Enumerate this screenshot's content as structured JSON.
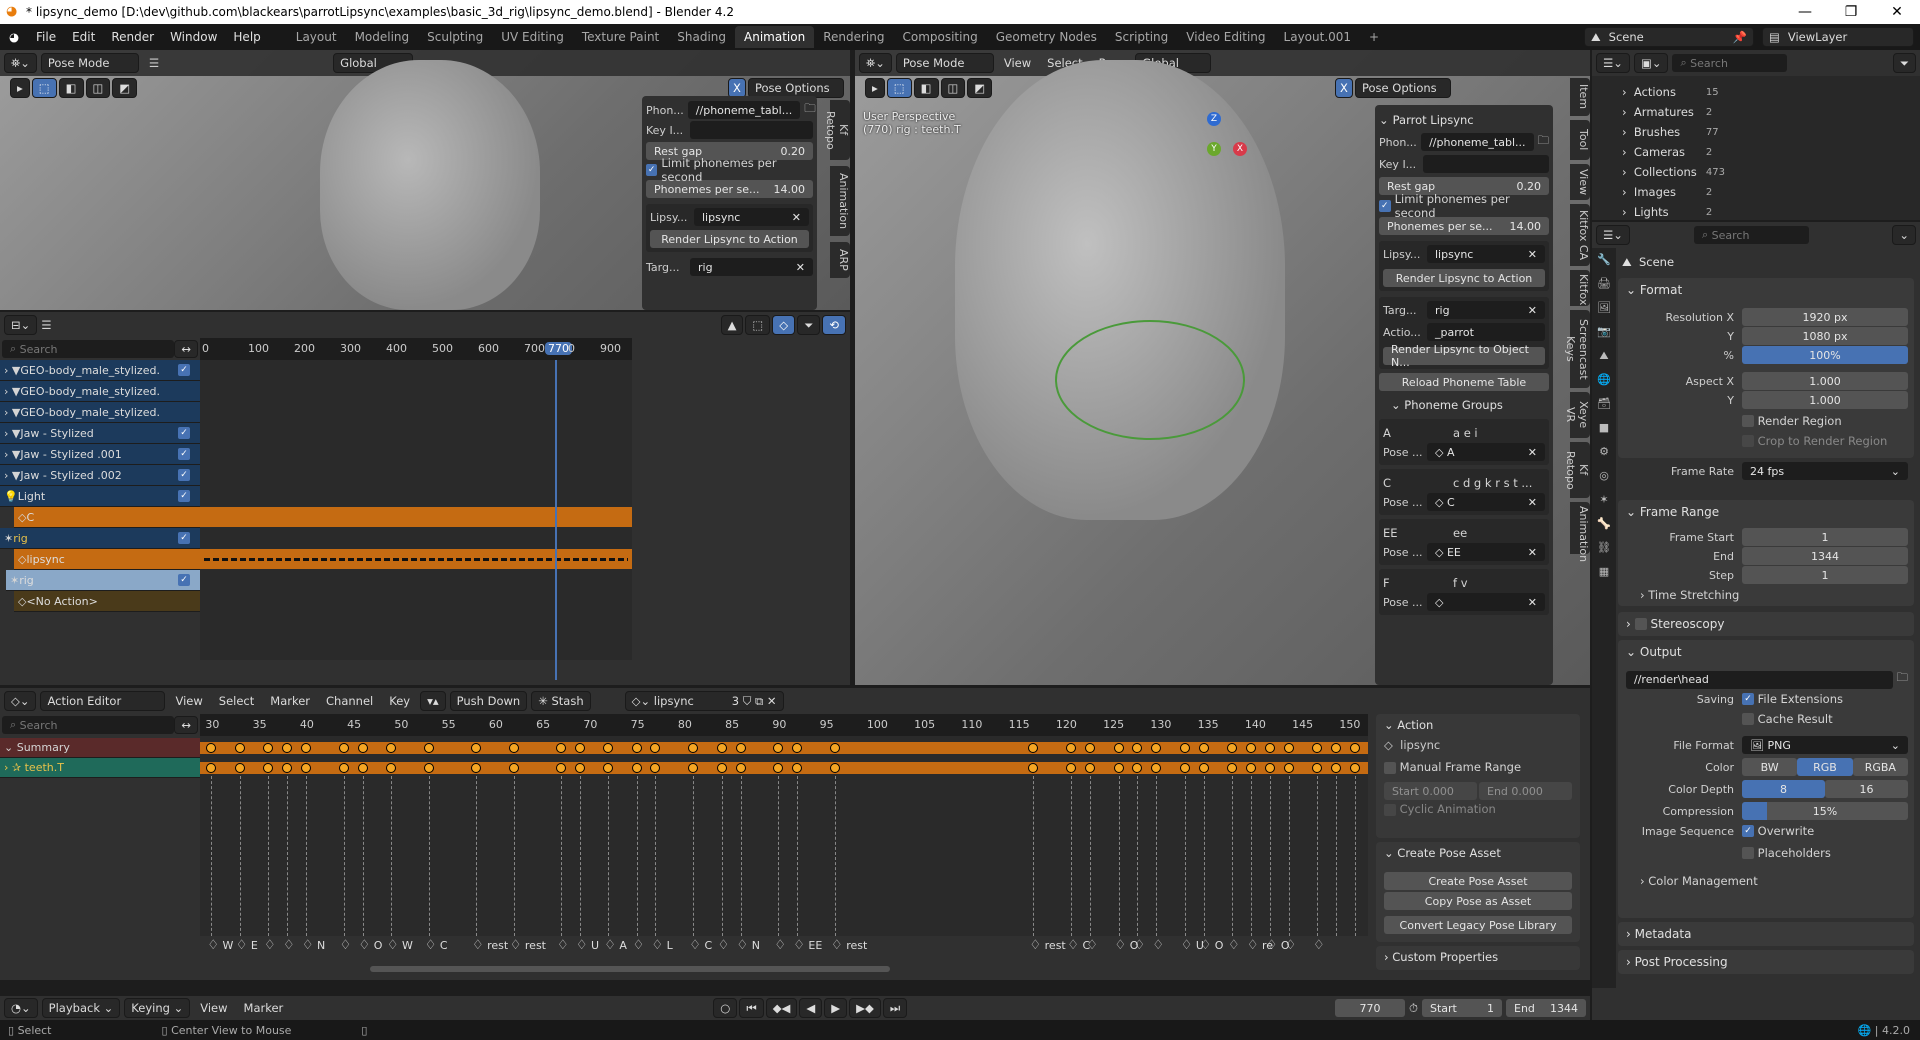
{
  "window": {
    "title": "* lipsync_demo [D:\\dev\\github.com\\blackears\\parrotLipsync\\examples\\basic_3d_rig\\lipsync_demo.blend] - Blender 4.2",
    "minimize": "—",
    "maximize": "❐",
    "close": "✕"
  },
  "menubar": {
    "items": [
      "File",
      "Edit",
      "Render",
      "Window",
      "Help"
    ],
    "workspaces": [
      "Layout",
      "Modeling",
      "Sculpting",
      "UV Editing",
      "Texture Paint",
      "Shading",
      "Animation",
      "Rendering",
      "Compositing",
      "Geometry Nodes",
      "Scripting",
      "Video Editing",
      "Layout.001",
      "+"
    ],
    "active_workspace": "Animation",
    "scene": "Scene",
    "view_layer": "ViewLayer"
  },
  "left_viewport": {
    "mode": "Pose Mode",
    "orientation": "Global",
    "pose_options": "Pose Options",
    "x_mirror": "X",
    "sidebar_tabs": [
      "Kf Retopo",
      "Animation",
      "ARP"
    ],
    "lipsync": {
      "phoneme_label": "Phon...",
      "phoneme_value": "//phoneme_tabl...",
      "key_label": "Key I...",
      "rest_gap_label": "Rest gap",
      "rest_gap": "0.20",
      "limit_label": "Limit phonemes per second",
      "pps_label": "Phonemes per se...",
      "pps": "14.00",
      "lipsync_label": "Lipsy...",
      "lipsync_value": "lipsync",
      "render_action": "Render Lipsync to Action",
      "target_label": "Targ...",
      "target_value": "rig"
    }
  },
  "right_viewport": {
    "mode": "Pose Mode",
    "menus": [
      "View",
      "Select",
      "Pose"
    ],
    "orientation": "Global",
    "pose_options": "Pose Options",
    "x_mirror": "X",
    "overlay_line1": "User Perspective",
    "overlay_line2": "(770) rig : teeth.T",
    "gizmo": {
      "z": "Z",
      "y": "Y",
      "x": "X"
    },
    "sidebar_tabs": [
      "Item",
      "Tool",
      "View",
      "Kitfox CA",
      "Kitfox",
      "Screencast Keys",
      "Xeye VR",
      "Kf Retopo",
      "Animation"
    ],
    "parrot": {
      "title": "Parrot Lipsync",
      "phoneme_label": "Phon...",
      "phoneme_value": "//phoneme_tabl...",
      "key_label": "Key I...",
      "rest_gap_label": "Rest gap",
      "rest_gap": "0.20",
      "limit_label": "Limit phonemes per second",
      "pps_label": "Phonemes per se...",
      "pps": "14.00",
      "lipsync_label": "Lipsy...",
      "lipsync_value": "lipsync",
      "render_action": "Render Lipsync to Action",
      "target_label": "Targ...",
      "target_value": "rig",
      "action_label": "Actio...",
      "action_value": "_parrot",
      "render_object": "Render Lipsync to Object N...",
      "reload": "Reload Phoneme Table",
      "groups_title": "Phoneme Groups",
      "pose_label": "Pose ...",
      "groups": [
        {
          "name": "A",
          "phonemes": "a e i",
          "pose": "A"
        },
        {
          "name": "C",
          "phonemes": "c d g k r s t ...",
          "pose": "C"
        },
        {
          "name": "EE",
          "phonemes": "ee",
          "pose": "EE"
        },
        {
          "name": "F",
          "phonemes": "f v",
          "pose": ""
        }
      ]
    }
  },
  "nla": {
    "search_placeholder": "Search",
    "ruler": [
      "0",
      "100",
      "200",
      "300",
      "400",
      "500",
      "600",
      "700",
      "770",
      "0",
      "900"
    ],
    "current_frame": "770",
    "tracks": [
      {
        "name": "GEO-body_male_stylized.",
        "type": "object",
        "checked": true
      },
      {
        "name": "GEO-body_male_stylized.",
        "type": "object",
        "checked": false
      },
      {
        "name": "GEO-body_male_stylized.",
        "type": "object",
        "checked": false
      },
      {
        "name": "Jaw - Stylized",
        "type": "object",
        "checked": true
      },
      {
        "name": "Jaw - Stylized .001",
        "type": "object",
        "checked": true
      },
      {
        "name": "Jaw - Stylized .002",
        "type": "object",
        "checked": true
      },
      {
        "name": "Light",
        "type": "light",
        "checked": true
      },
      {
        "name": "C",
        "type": "action",
        "checked": false
      },
      {
        "name": "rig",
        "type": "armature",
        "checked": true
      },
      {
        "name": "lipsync",
        "type": "action",
        "checked": false
      },
      {
        "name": "rig",
        "type": "armature-sel",
        "checked": true
      },
      {
        "name": "<No Action>",
        "type": "noaction",
        "checked": false
      }
    ]
  },
  "action_editor": {
    "mode": "Action Editor",
    "menus": [
      "View",
      "Select",
      "Marker",
      "Channel",
      "Key"
    ],
    "push_down": "Push Down",
    "stash": "Stash",
    "action_name": "lipsync",
    "users": "3",
    "search_placeholder": "Search",
    "ruler": [
      "30",
      "35",
      "40",
      "45",
      "50",
      "55",
      "60",
      "65",
      "70",
      "75",
      "80",
      "85",
      "90",
      "95",
      "100",
      "105",
      "110",
      "115",
      "120",
      "125",
      "130",
      "135",
      "140",
      "145",
      "150"
    ],
    "channels": [
      {
        "name": "Summary"
      },
      {
        "name": "teeth.T"
      }
    ],
    "keyframes": [
      30,
      33,
      36,
      38,
      40,
      44,
      46,
      49,
      53,
      58,
      62,
      67,
      69,
      72,
      75,
      77,
      81,
      84,
      86,
      90,
      92,
      96,
      117,
      121,
      123,
      126,
      128,
      130,
      133,
      135,
      138,
      140,
      142,
      144,
      147,
      149,
      151
    ],
    "markers": [
      "W",
      "E",
      "",
      "",
      "N",
      "",
      "O",
      "W",
      "C",
      "rest",
      "rest",
      "",
      "U",
      "A",
      "",
      "L",
      "C",
      "",
      "N",
      "",
      "EE",
      "rest",
      "rest",
      "C",
      "",
      "O",
      "",
      "",
      "U",
      "O",
      "",
      "re",
      "O",
      "",
      ""
    ],
    "sidebar": {
      "action_title": "Action",
      "action_name": "lipsync",
      "manual_range": "Manual Frame Range",
      "start_label": "Start",
      "start": "0.000",
      "end_label": "End",
      "end": "0.000",
      "cyclic": "Cyclic Animation",
      "pose_asset_title": "Create Pose Asset",
      "create_pose": "Create Pose Asset",
      "copy_pose": "Copy Pose as Asset",
      "convert": "Convert Legacy Pose Library",
      "custom_props": "Custom Properties"
    }
  },
  "timeline": {
    "menus": [
      "Playback",
      "Keying",
      "View",
      "Marker"
    ],
    "current_frame": "770",
    "start_label": "Start",
    "start": "1",
    "end_label": "End",
    "end": "1344"
  },
  "statusbar": {
    "select": "Select",
    "center": "Center View to Mouse",
    "version": "4.2.0"
  },
  "outliner": {
    "search_placeholder": "Search",
    "items": [
      {
        "name": "Actions",
        "count": "15"
      },
      {
        "name": "Armatures",
        "count": "2"
      },
      {
        "name": "Brushes",
        "count": "77"
      },
      {
        "name": "Cameras",
        "count": "2"
      },
      {
        "name": "Collections",
        "count": "473"
      },
      {
        "name": "Images",
        "count": "2"
      },
      {
        "name": "Lights",
        "count": "2"
      }
    ]
  },
  "properties": {
    "search_placeholder": "Search",
    "context": "Scene",
    "format": {
      "title": "Format",
      "res_x_label": "Resolution X",
      "res_x": "1920 px",
      "res_y_label": "Y",
      "res_y": "1080 px",
      "pct_label": "%",
      "pct": "100%",
      "aspect_x_label": "Aspect X",
      "aspect_x": "1.000",
      "aspect_y_label": "Y",
      "aspect_y": "1.000",
      "render_region": "Render Region",
      "crop": "Crop to Render Region",
      "frame_rate_label": "Frame Rate",
      "frame_rate": "24 fps"
    },
    "frame_range": {
      "title": "Frame Range",
      "start_label": "Frame Start",
      "start": "1",
      "end_label": "End",
      "end": "1344",
      "step_label": "Step",
      "step": "1",
      "time_stretching": "Time Stretching"
    },
    "stereoscopy": "Stereoscopy",
    "output": {
      "title": "Output",
      "path": "//render\\head",
      "saving_label": "Saving",
      "file_ext": "File Extensions",
      "cache": "Cache Result",
      "file_format_label": "File Format",
      "file_format": "PNG",
      "color_label": "Color",
      "color_options": [
        "BW",
        "RGB",
        "RGBA"
      ],
      "color_selected": "RGB",
      "depth_label": "Color Depth",
      "depth_options": [
        "8",
        "16"
      ],
      "depth_selected": "8",
      "compression_label": "Compression",
      "compression": "15%",
      "compression_fraction": 0.15,
      "image_seq_label": "Image Sequence",
      "overwrite": "Overwrite",
      "placeholders": "Placeholders",
      "color_mgmt": "Color Management"
    },
    "metadata": "Metadata",
    "post_processing": "Post Processing"
  }
}
